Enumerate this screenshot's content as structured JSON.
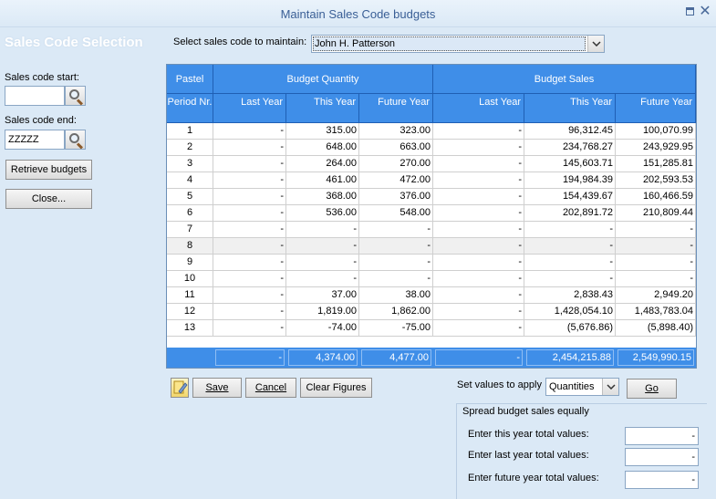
{
  "window": {
    "title": "Maintain Sales Code budgets"
  },
  "left": {
    "section_title": "Sales Code Selection",
    "start_label": "Sales code start:",
    "start_value": "",
    "end_label": "Sales code end:",
    "end_value": "ZZZZZ",
    "retrieve_label": "Retrieve budgets",
    "close_label": "Close..."
  },
  "selector": {
    "label": "Select sales code to maintain:",
    "value": "John H. Patterson"
  },
  "grid": {
    "group_headers": {
      "pastel": "Pastel",
      "quantity": "Budget Quantity",
      "sales": "Budget Sales"
    },
    "columns": [
      "Period Nr.",
      "Last Year",
      "This Year",
      "Future Year",
      "Last Year",
      "This Year",
      "Future Year"
    ],
    "rows": [
      [
        "1",
        "-",
        "315.00",
        "323.00",
        "-",
        "96,312.45",
        "100,070.99"
      ],
      [
        "2",
        "-",
        "648.00",
        "663.00",
        "-",
        "234,768.27",
        "243,929.95"
      ],
      [
        "3",
        "-",
        "264.00",
        "270.00",
        "-",
        "145,603.71",
        "151,285.81"
      ],
      [
        "4",
        "-",
        "461.00",
        "472.00",
        "-",
        "194,984.39",
        "202,593.53"
      ],
      [
        "5",
        "-",
        "368.00",
        "376.00",
        "-",
        "154,439.67",
        "160,466.59"
      ],
      [
        "6",
        "-",
        "536.00",
        "548.00",
        "-",
        "202,891.72",
        "210,809.44"
      ],
      [
        "7",
        "-",
        "-",
        "-",
        "-",
        "-",
        "-"
      ],
      [
        "8",
        "-",
        "-",
        "-",
        "-",
        "-",
        "-"
      ],
      [
        "9",
        "-",
        "-",
        "-",
        "-",
        "-",
        "-"
      ],
      [
        "10",
        "-",
        "-",
        "-",
        "-",
        "-",
        "-"
      ],
      [
        "11",
        "-",
        "37.00",
        "38.00",
        "-",
        "2,838.43",
        "2,949.20"
      ],
      [
        "12",
        "-",
        "1,819.00",
        "1,862.00",
        "-",
        "1,428,054.10",
        "1,483,783.04"
      ],
      [
        "13",
        "-",
        "-74.00",
        "-75.00",
        "-",
        "(5,676.86)",
        "(5,898.40)"
      ]
    ],
    "totals": [
      "-",
      "4,374.00",
      "4,477.00",
      "-",
      "2,454,215.88",
      "2,549,990.15"
    ]
  },
  "actions": {
    "save_label": "Save",
    "cancel_label": "Cancel",
    "clear_label": "Clear Figures",
    "set_values_label": "Set values to apply",
    "set_values_value": "Quantities",
    "go_label": "Go"
  },
  "spread": {
    "legend": "Spread budget sales equally",
    "this_year_label": "Enter this year total values:",
    "this_year_value": "-",
    "last_year_label": "Enter last year total values:",
    "last_year_value": "-",
    "future_year_label": "Enter future year total values:",
    "future_year_value": "-"
  }
}
